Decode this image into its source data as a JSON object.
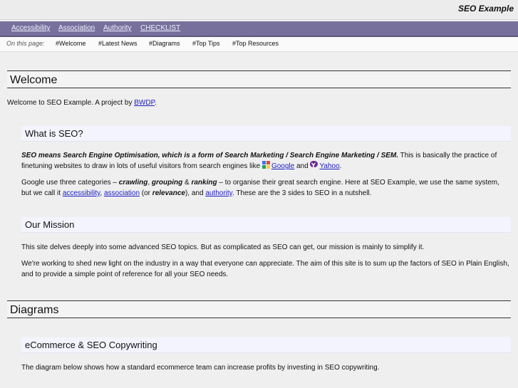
{
  "header": {
    "brand": "SEO Example"
  },
  "nav": {
    "items": [
      {
        "label": "Accessibility"
      },
      {
        "label": "Association"
      },
      {
        "label": "Authority"
      },
      {
        "label": "CHECKLIST"
      }
    ]
  },
  "on_page": {
    "label": "On this page:",
    "links": [
      {
        "label": "#Welcome"
      },
      {
        "label": "#Latest News"
      },
      {
        "label": "#Diagrams"
      },
      {
        "label": "#Top Tips"
      },
      {
        "label": "#Top Resources"
      }
    ]
  },
  "welcome": {
    "heading": "Welcome",
    "intro_text": "Welcome to SEO Example. A project by ",
    "intro_link": "BWDP",
    "intro_end": "."
  },
  "what_is_seo": {
    "heading": "What is SEO?",
    "p1_bold": "SEO means Search Engine Optimisation, which is a form of Search Marketing / Search Engine Marketing / SEM.",
    "p1_text": " This is basically the practice of finetuning websites to draw in lots of useful visitors from search engines like ",
    "google_label": "Google",
    "and_text": " and ",
    "yahoo_label": "Yahoo",
    "p1_end": ".",
    "p2_a": "Google use three categories – ",
    "p2_crawling": "crawling",
    "p2_sep1": ", ",
    "p2_grouping": "grouping",
    "p2_amp": " & ",
    "p2_ranking": "ranking",
    "p2_b": " – to organise their great search engine. Here at SEO Example, we use the same system, but we call it ",
    "p2_accessibility": "accessibility",
    "p2_sep2": ", ",
    "p2_association": "association",
    "p2_or": " (or ",
    "p2_relevance": "relevance",
    "p2_c": "), and ",
    "p2_authority": "authority",
    "p2_end": ". These are the 3 sides to SEO in a nutshell."
  },
  "mission": {
    "heading": "Our Mission",
    "p1": "This site delves deeply into some advanced SEO topics. But as complicated as SEO can get, our mission is mainly to simplify it.",
    "p2": "We're working to shed new light on the industry in a way that everyone can appreciate. The aim of this site is to sum up the factors of SEO in Plain English, and to provide a simple point of reference for all your SEO needs."
  },
  "diagrams": {
    "heading": "Diagrams",
    "sub_heading": "eCommerce & SEO Copywriting",
    "p1": "The diagram below shows how a standard ecommerce team can increase profits by investing in SEO copywriting."
  },
  "colors": {
    "nav_bg": "#77709d",
    "link": "#1c1cc8",
    "subheading_bg": "#f4f4ff"
  }
}
